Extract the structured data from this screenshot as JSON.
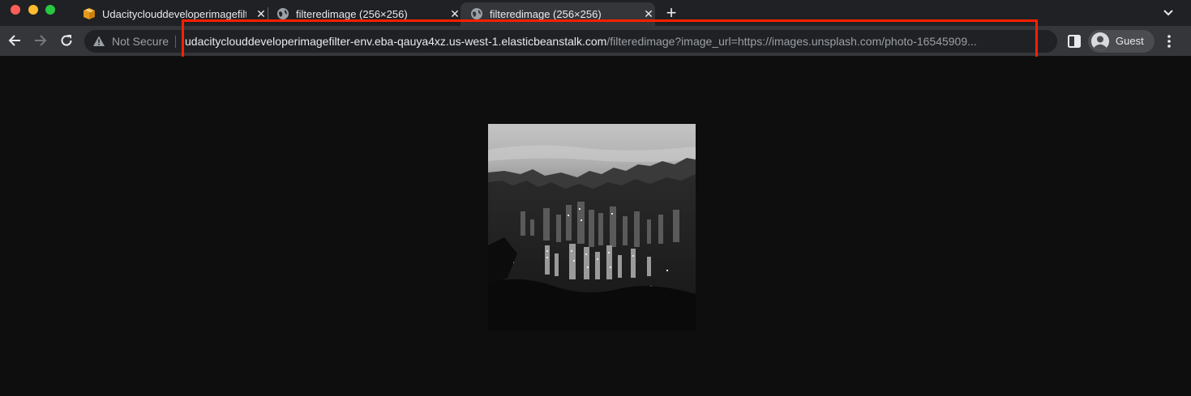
{
  "window": {
    "traffic_lights": {
      "close_color": "#ff5f57",
      "minimize_color": "#febc2e",
      "zoom_color": "#28c840"
    }
  },
  "tabs": [
    {
      "title": "Udacityclouddeveloperimagefilter-env",
      "favicon": "aws-box-icon",
      "active": false
    },
    {
      "title": "filteredimage (256×256)",
      "favicon": "globe-icon",
      "active": false
    },
    {
      "title": "filteredimage (256×256)",
      "favicon": "globe-icon",
      "active": true
    }
  ],
  "toolbar": {
    "security_label": "Not Secure",
    "url_host": "udacityclouddeveloperimagefilter-env.eba-qauya4xz.us-west-1.elasticbeanstalk.com",
    "url_path": "/filteredimage?image_url=https://images.unsplash.com/photo-16545909...",
    "profile_label": "Guest"
  },
  "annotation": {
    "highlight_color": "#ff1f00"
  },
  "page": {
    "image_description": "black and white night city skyline with mountains"
  }
}
